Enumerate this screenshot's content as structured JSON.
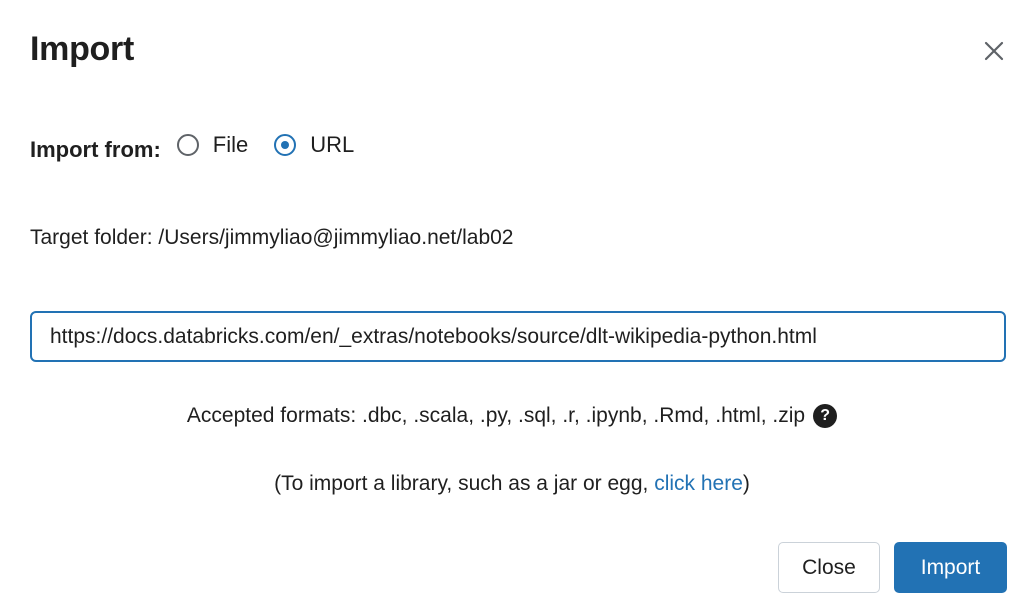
{
  "dialog": {
    "title": "Import",
    "close_icon": "close-icon"
  },
  "import_from": {
    "label": "Import from:",
    "options": [
      {
        "label": "File",
        "selected": false
      },
      {
        "label": "URL",
        "selected": true
      }
    ]
  },
  "target_folder": {
    "text": "Target folder: /Users/jimmyliao@jimmyliao.net/lab02"
  },
  "url_field": {
    "value": "https://docs.databricks.com/en/_extras/notebooks/source/dlt-wikipedia-python.html"
  },
  "formats": {
    "text": "Accepted formats: .dbc, .scala, .py, .sql, .r, .ipynb, .Rmd, .html, .zip",
    "help_icon": "?"
  },
  "library_note": {
    "prefix": "(To import a library, such as a jar or egg, ",
    "link": "click here",
    "suffix": ")"
  },
  "buttons": {
    "close": "Close",
    "import": "Import"
  },
  "colors": {
    "accent": "#2272b4",
    "text": "#1f1f1f"
  }
}
